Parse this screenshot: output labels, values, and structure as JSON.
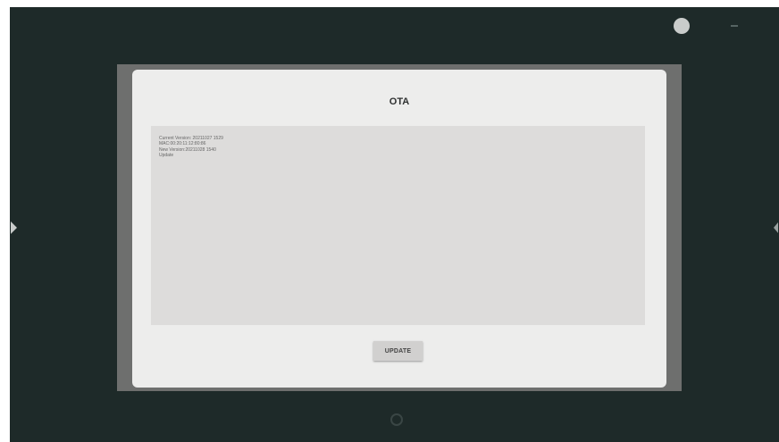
{
  "dialog": {
    "title": "OTA",
    "info_lines": [
      "Current Version: 20211027 1529",
      "MAC:00:20:11:12:80:86",
      "New Version:20211028 1540",
      "Update"
    ],
    "update_label": "UPDATE"
  },
  "colors": {
    "screen_background": "#1e2a29",
    "dialog_background": "#ededec",
    "info_box_background": "#dddcdb",
    "button_background": "#d1d0cf"
  },
  "icons": {
    "status_indicator": "circle-icon",
    "left_edge": "chevron-right-icon",
    "right_edge": "chevron-left-icon",
    "bottom_nav": "home-circle-icon"
  }
}
